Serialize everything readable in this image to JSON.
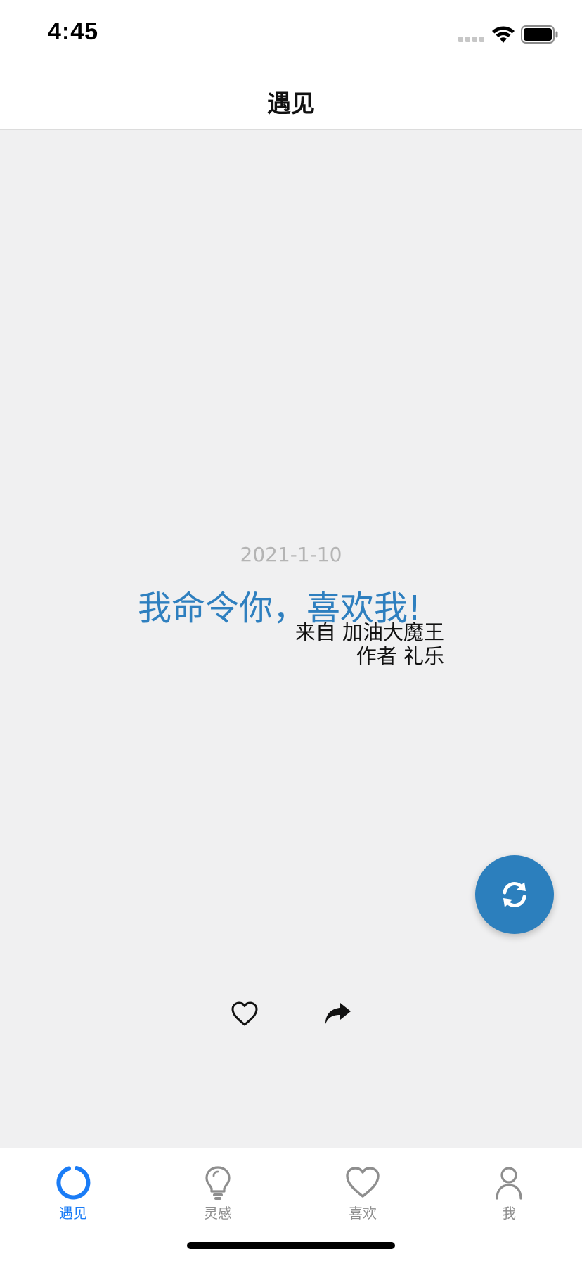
{
  "status_bar": {
    "time": "4:45"
  },
  "nav": {
    "title": "遇见"
  },
  "card": {
    "date": "2021-1-10",
    "quote": "我命令你，喜欢我!",
    "source": "来自 加油大魔王",
    "author": "作者 礼乐"
  },
  "actions": {
    "refresh_icon": "refresh-icon",
    "like_icon": "heart-outline-icon",
    "share_icon": "share-arrow-icon"
  },
  "tabs": [
    {
      "label": "遇见",
      "icon": "ring-icon",
      "active": true
    },
    {
      "label": "灵感",
      "icon": "lightbulb-icon",
      "active": false
    },
    {
      "label": "喜欢",
      "icon": "heart-icon",
      "active": false
    },
    {
      "label": "我",
      "icon": "person-icon",
      "active": false
    }
  ],
  "colors": {
    "accent": "#1a7cf6",
    "quote": "#2e7fbf",
    "fab": "#2c7fbd",
    "inactive": "#8e8e8e",
    "date": "#b4b4b4"
  }
}
